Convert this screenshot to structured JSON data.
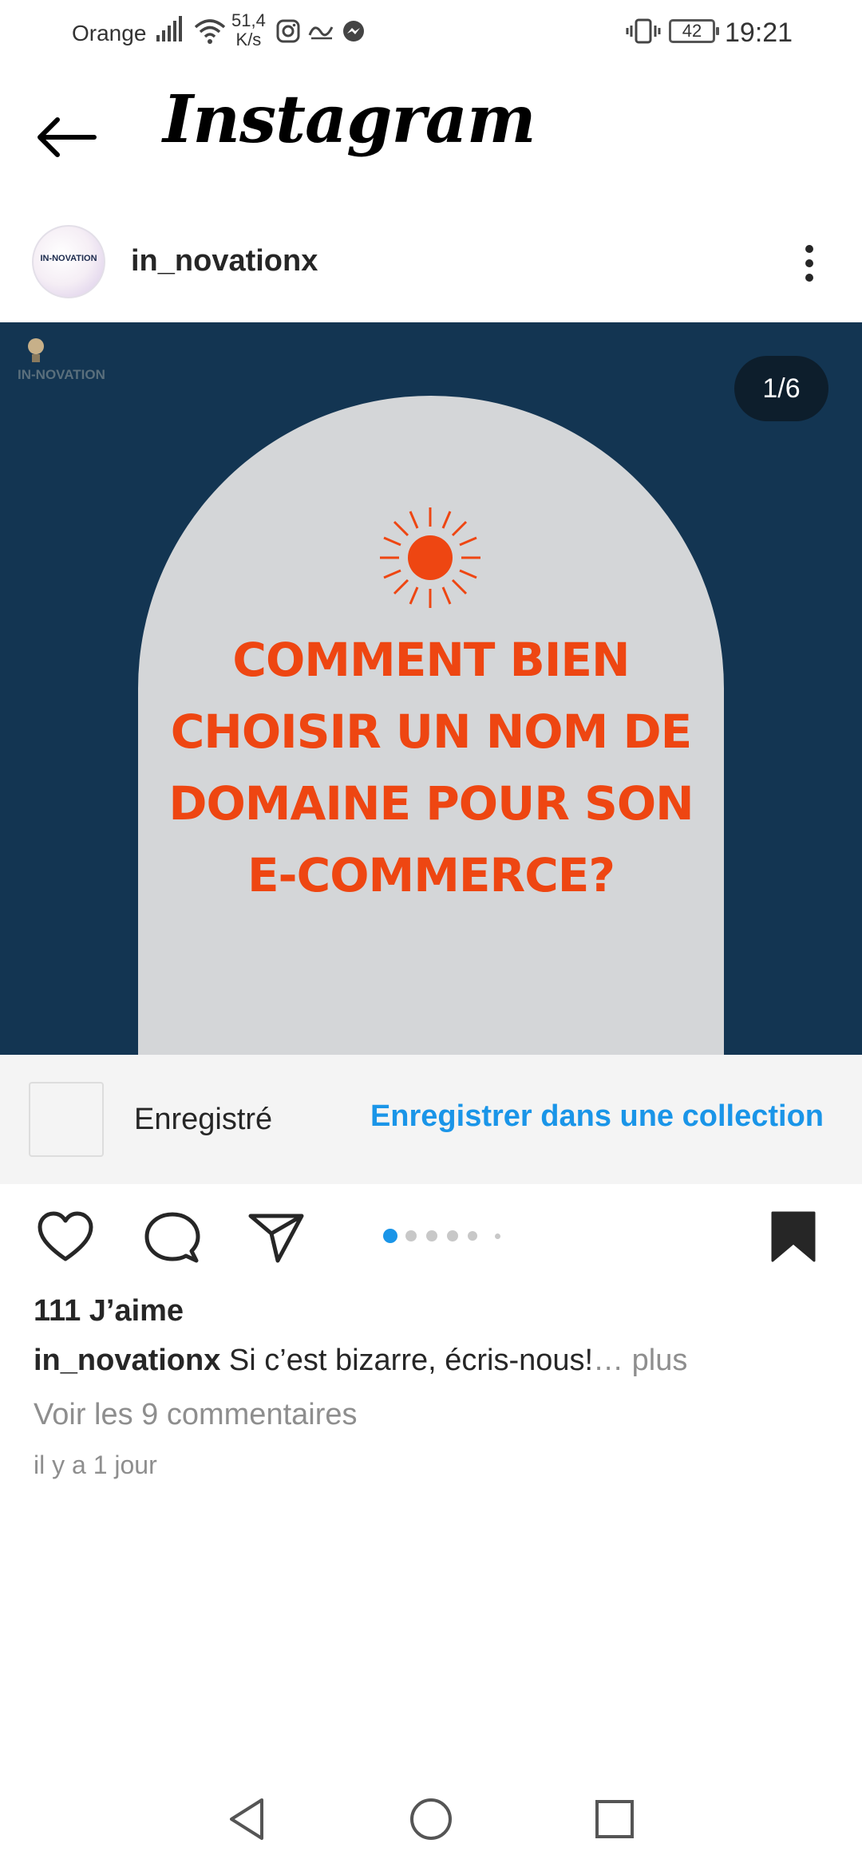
{
  "status_bar": {
    "carrier": "Orange",
    "speed_value": "51,4",
    "speed_unit": "K/s",
    "battery": "42",
    "time": "19:21"
  },
  "header": {
    "title": "Instagram"
  },
  "post": {
    "username": "in_novationx",
    "avatar_text": "IN-NOVATION",
    "brand_mark": "IN-NOVATION",
    "counter": "1/6",
    "headline_lines": [
      "COMMENT BIEN",
      "CHOISIR UN NOM DE",
      "DOMAINE POUR SON",
      "E-COMMERCE?"
    ],
    "current_slide": 1,
    "total_slides": 6
  },
  "saved_banner": {
    "label": "Enregistré",
    "collection_link": "Enregistrer dans une collection"
  },
  "actions": {
    "like_icon": "heart-icon",
    "comment_icon": "speech-bubble-icon",
    "share_icon": "paper-plane-icon",
    "save_icon": "bookmark-filled-icon"
  },
  "details": {
    "likes": "111 J’aime",
    "caption_user": "in_novationx",
    "caption_text": " Si c’est bizarre, écris-nous!",
    "caption_more": "… plus",
    "view_comments": "Voir les 9 commentaires",
    "timestamp": "il y a 1 jour"
  },
  "colors": {
    "link_blue": "#1a95e8",
    "image_background": "#133552",
    "headline_orange": "#ee4612",
    "arch_gray": "#d4d6d8"
  }
}
